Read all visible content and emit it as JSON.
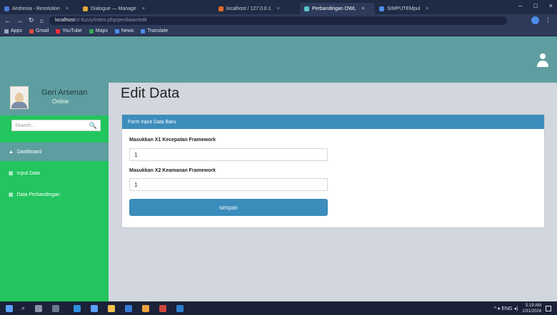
{
  "browser": {
    "tabs": [
      {
        "label": "Andrexia - Resolution",
        "active": false
      },
      {
        "label": "Dialogue — Manage",
        "active": false
      },
      {
        "label": "localhost / 127.0.0.1",
        "active": false
      },
      {
        "label": "Perbandingan OWL",
        "active": true
      },
      {
        "label": "SIMPUTEMpul",
        "active": false
      }
    ],
    "tab_close": "×",
    "nav": {
      "back": "←",
      "forward": "→",
      "reload": "↻",
      "home": "⌂"
    },
    "url_host": "localhost",
    "url_path": "/ci-fuzzy/index.php/penilaian/edit",
    "menu_glyph": "⋮",
    "bookmarks": [
      {
        "label": "Apps",
        "color": "#9aa6bd"
      },
      {
        "label": "Gmail",
        "color": "#e24c3f"
      },
      {
        "label": "YouTube",
        "color": "#ff2f2f"
      },
      {
        "label": "Maps",
        "color": "#34a853"
      },
      {
        "label": "News",
        "color": "#4d8dea"
      },
      {
        "label": "Translate",
        "color": "#4d8dea"
      }
    ],
    "window_controls": [
      "–",
      "□",
      "×"
    ]
  },
  "header": {
    "user_icon": "user-icon"
  },
  "sidebar": {
    "profile_name": "Geri Arsenan",
    "profile_status": "Online",
    "search_placeholder": "Search...",
    "search_icon": "🔍",
    "items": [
      {
        "label": "Dashboard",
        "icon": "▲",
        "active": true
      },
      {
        "label": "Input Data",
        "icon": "▦",
        "active": false
      },
      {
        "label": "Data Perbandingan",
        "icon": "▦",
        "active": false
      }
    ]
  },
  "main": {
    "title": "Edit Data",
    "card_header": "Form Input Data Baru",
    "fields": [
      {
        "label": "Masukkan X1 Kecepatan Framework",
        "value": "1"
      },
      {
        "label": "Masukkan X2 Keamanan Framework",
        "value": "1"
      }
    ],
    "submit_label": "simpan"
  },
  "taskbar": {
    "search_glyph": "⌕",
    "tray_text": "^ ♦ ENG ◂)",
    "time": "5:19 AM",
    "date": "1/31/2024"
  }
}
